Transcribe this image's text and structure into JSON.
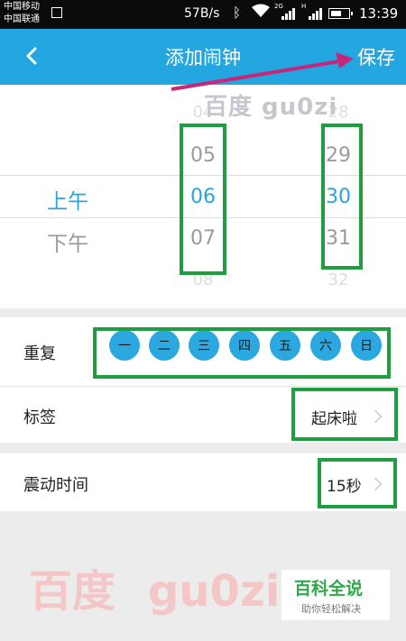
{
  "status_bar": {
    "carrier_1": "中国移动",
    "carrier_2": "中国联通",
    "network_speed": "57B/s",
    "signal_1_tag": "2G",
    "signal_2_tag": "H",
    "time": "13:39",
    "battery_level": 0.62
  },
  "header": {
    "title": "添加闹钟",
    "save_label": "保存"
  },
  "time_picker": {
    "ampm": {
      "selected": "上午",
      "next": "下午"
    },
    "hours": {
      "far_prev": "04",
      "prev": "05",
      "selected": "06",
      "next": "07",
      "far_next": "08"
    },
    "minutes": {
      "far_prev": "28",
      "prev": "29",
      "selected": "30",
      "next": "31",
      "far_next": "32"
    }
  },
  "repeat": {
    "label": "重复",
    "days": [
      "一",
      "二",
      "三",
      "四",
      "五",
      "六",
      "日"
    ]
  },
  "tag": {
    "label": "标签",
    "value": "起床啦"
  },
  "vibrate": {
    "label": "震动时间",
    "value": "15秒"
  },
  "watermarks": {
    "top": "百度 gu0zi",
    "bottom_cn": "百度",
    "bottom_en": "gu0zi",
    "logo_main": "百科全说",
    "logo_sub": "助你轻松解决"
  },
  "colors": {
    "accent": "#24a6e0",
    "selected_text": "#2ba3dc",
    "highlight_box": "#1f9e3f",
    "annotation_arrow": "#c8267a"
  }
}
